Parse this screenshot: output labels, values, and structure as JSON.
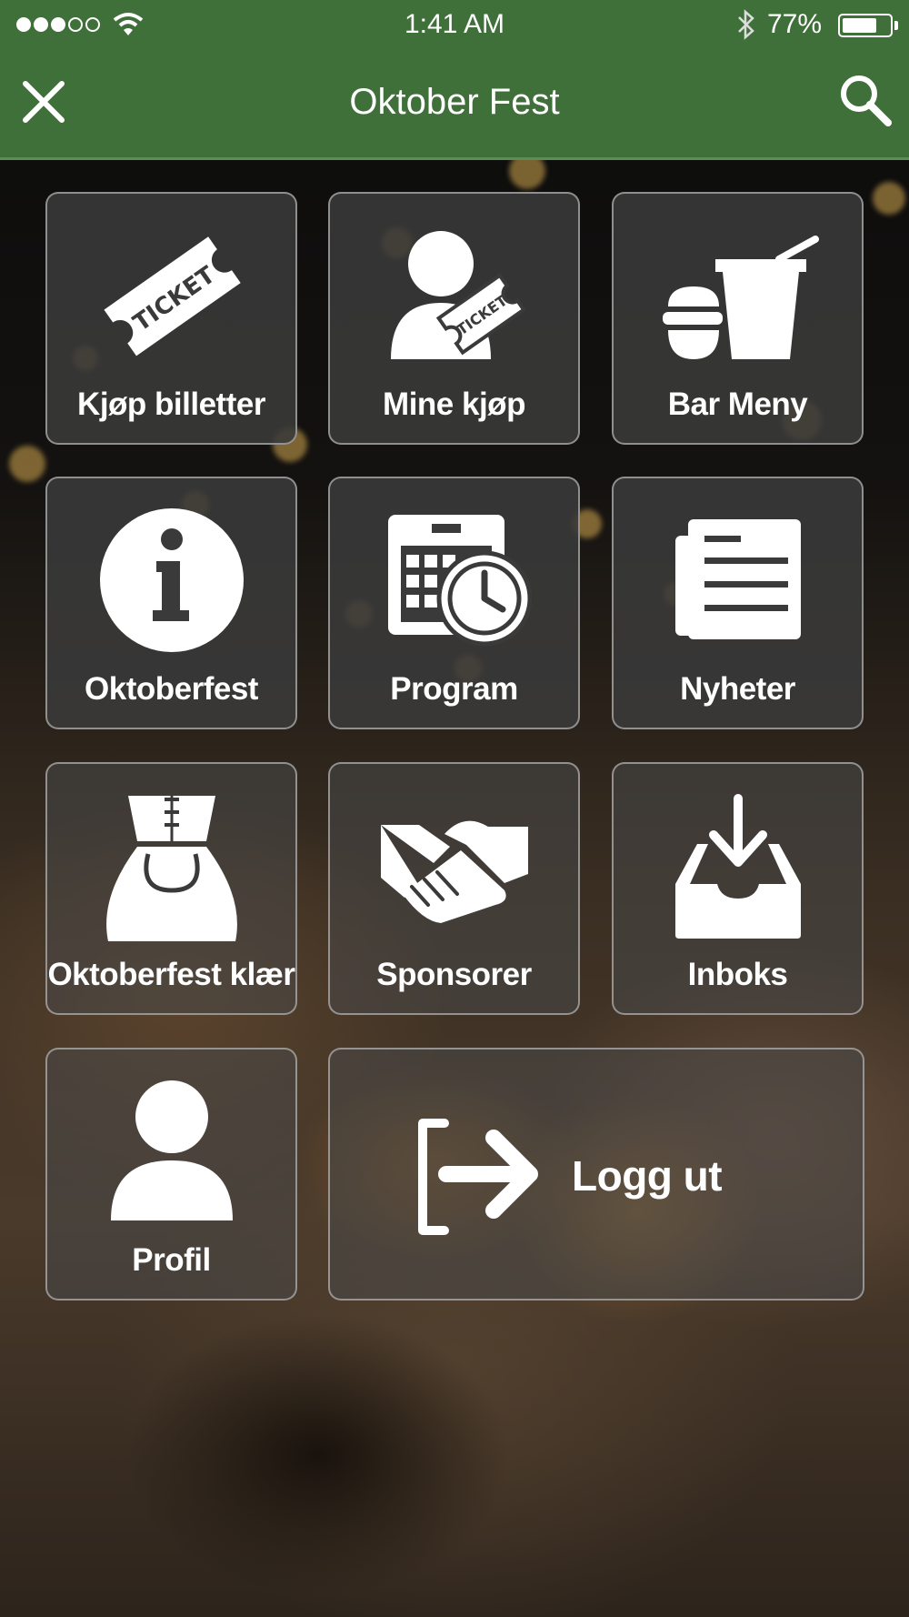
{
  "status_bar": {
    "time": "1:41 AM",
    "battery_percent": "77%",
    "battery_level": 0.77,
    "signal_bars_filled": 3,
    "signal_bars_total": 5
  },
  "nav": {
    "title": "Oktober Fest",
    "close_icon": "close-icon",
    "search_icon": "search-icon"
  },
  "colors": {
    "header_bg": "#40703a",
    "tile_bg": "#3a3a3a",
    "tile_text": "#ffffff"
  },
  "menu": [
    {
      "label": "Kjøp billetter",
      "icon": "ticket-icon"
    },
    {
      "label": "Mine kjøp",
      "icon": "user-ticket-icon"
    },
    {
      "label": "Bar Meny",
      "icon": "food-drink-icon"
    },
    {
      "label": "Oktoberfest",
      "icon": "info-icon"
    },
    {
      "label": "Program",
      "icon": "calendar-clock-icon"
    },
    {
      "label": "Nyheter",
      "icon": "newspaper-icon"
    },
    {
      "label": "Oktoberfest klær",
      "icon": "dirndl-icon"
    },
    {
      "label": "Sponsorer",
      "icon": "handshake-icon"
    },
    {
      "label": "Inboks",
      "icon": "inbox-download-icon"
    },
    {
      "label": "Profil",
      "icon": "person-icon"
    },
    {
      "label": "Logg ut",
      "icon": "logout-icon"
    }
  ]
}
